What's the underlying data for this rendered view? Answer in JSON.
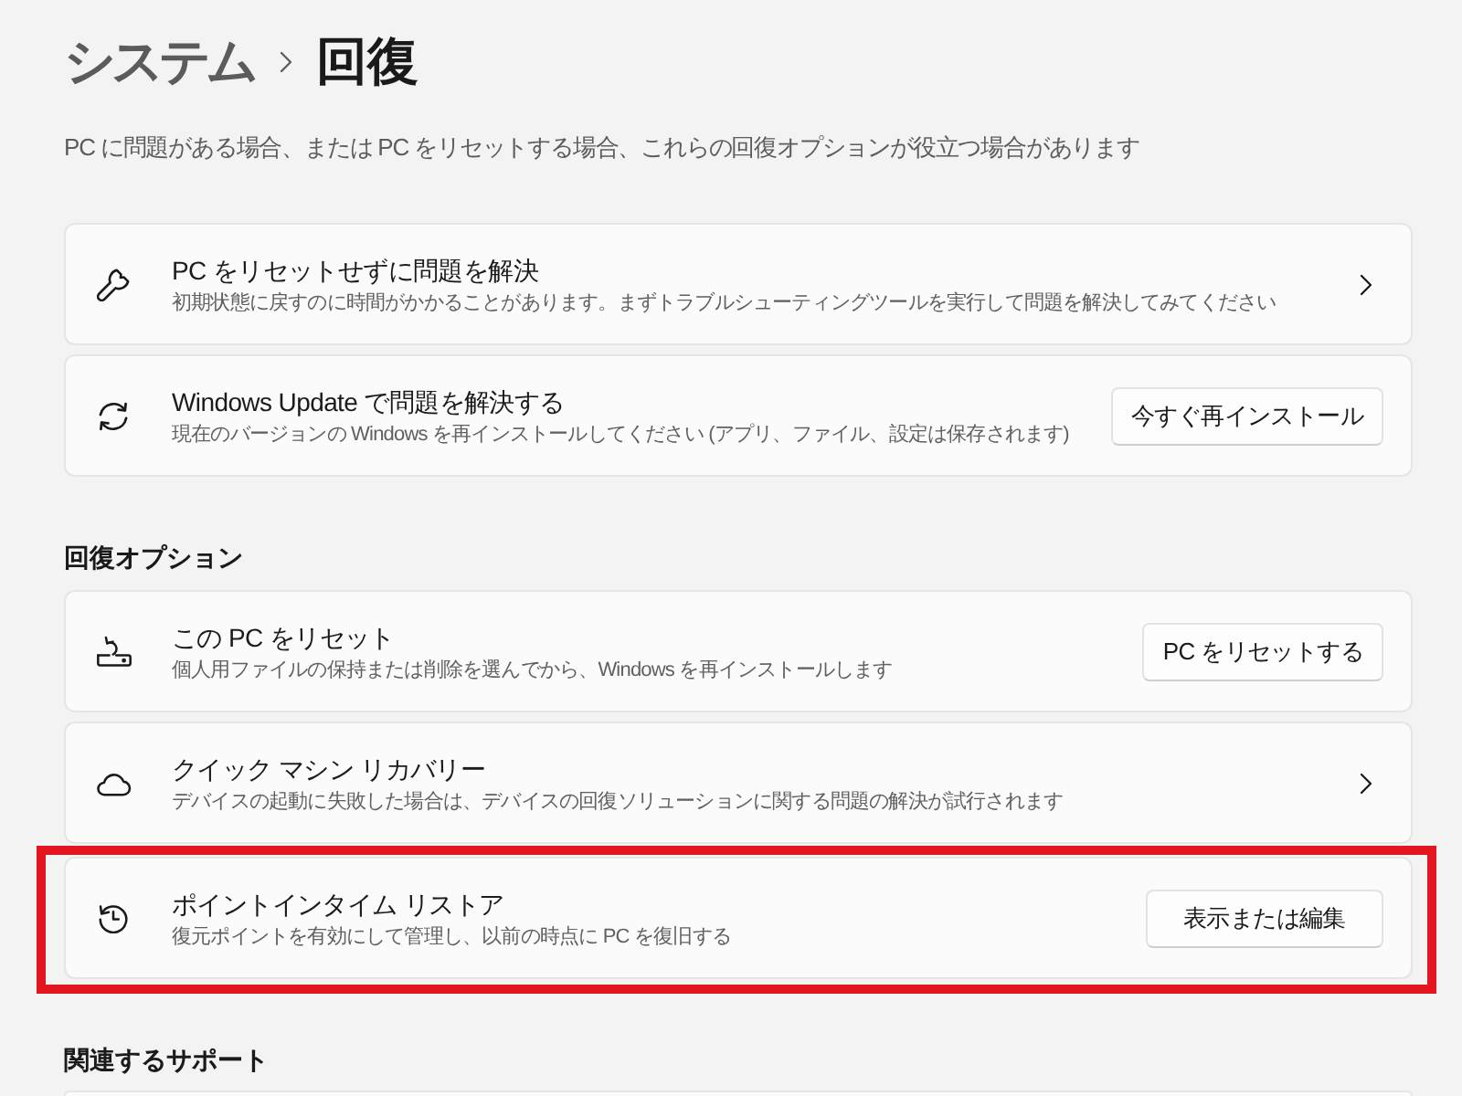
{
  "header": {
    "breadcrumb_parent": "システム",
    "title": "回復"
  },
  "description": "PC に問題がある場合、または PC をリセットする場合、これらの回復オプションが役立つ場合があります",
  "sections": [
    {
      "cards": [
        {
          "title": "PC をリセットせずに問題を解決",
          "subtitle": "初期状態に戻すのに時間がかかることがあります。まずトラブルシューティングツールを実行して問題を解決してみてください",
          "action": {
            "kind": "chevron"
          },
          "highlighted": false
        },
        {
          "title": "Windows Update で問題を解決する",
          "subtitle": "現在のバージョンの Windows を再インストールしてください (アプリ、ファイル、設定は保存されます)",
          "action": {
            "kind": "button",
            "label": "今すぐ再インストール"
          },
          "highlighted": false
        }
      ]
    },
    {
      "heading": "回復オプション",
      "cards": [
        {
          "title": "この PC をリセット",
          "subtitle": "個人用ファイルの保持または削除を選んでから、Windows を再インストールします",
          "action": {
            "kind": "button",
            "label": "PC をリセットする"
          },
          "highlighted": false
        },
        {
          "title": "クイック マシン リカバリー",
          "subtitle": "デバイスの起動に失敗した場合は、デバイスの回復ソリューションに関する問題の解決が試行されます",
          "action": {
            "kind": "chevron"
          },
          "highlighted": false
        },
        {
          "title": "ポイントインタイム リストア",
          "subtitle": "復元ポイントを有効にして管理し、以前の時点に PC を復旧する",
          "action": {
            "kind": "button",
            "label": "表示または編集"
          },
          "highlighted": true
        }
      ]
    },
    {
      "heading": "関連するサポート"
    }
  ]
}
